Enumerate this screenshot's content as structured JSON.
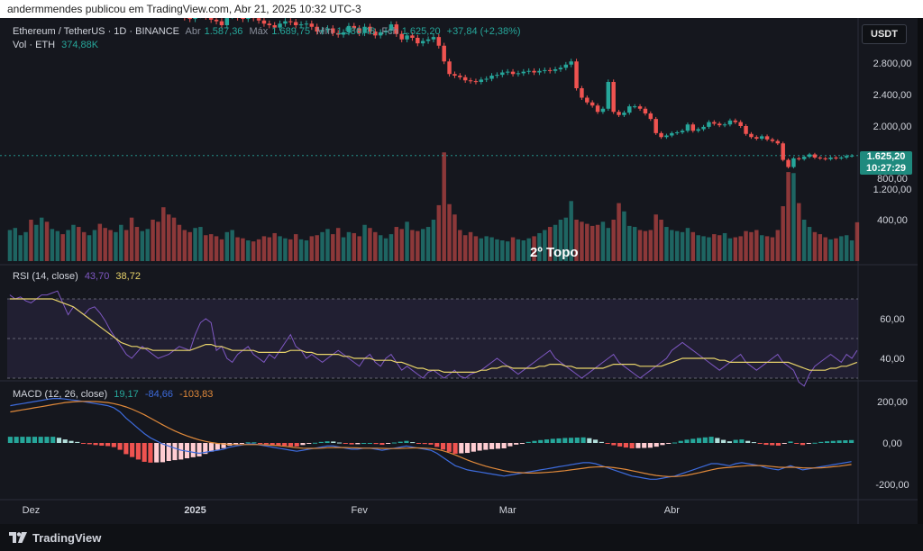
{
  "header": {
    "credit": "andermmendes publicou em TradingView.com, Abr 21, 2025 10:32 UTC-3"
  },
  "symbol": {
    "name": "Ethereum / TetherUS · 1D · BINANCE",
    "open_label": "Abr",
    "open": "1.587,36",
    "high_label": "Máx",
    "high": "1.689,75",
    "low_label": "Mín",
    "low": "1.586,48",
    "close_label": "Fch",
    "close": "1.625,20",
    "change": "+37,84 (+2,38%)"
  },
  "volume": {
    "label": "Vol · ETH",
    "value": "374,88K"
  },
  "rsi": {
    "label": "RSI (14, close)",
    "value1": "43,70",
    "value2": "38,72"
  },
  "macd": {
    "label": "MACD (12, 26, close)",
    "hist": "19,17",
    "macd": "-84,66",
    "signal": "-103,83"
  },
  "currency_button": "USDT",
  "price_tag": {
    "price": "1.625,20",
    "countdown": "10:27:29"
  },
  "annotation": "2º Topo",
  "footer": {
    "brand": "TradingView"
  },
  "colors": {
    "up": "#26a69a",
    "down": "#ef5350",
    "rsi": "#7e57c2",
    "rsi_ma": "#e8d36a",
    "macd": "#3d6bdc",
    "signal": "#e0893a",
    "background": "#15171e"
  },
  "chart_data": [
    {
      "type": "candlestick",
      "title": "Ethereum / TetherUS · 1D · BINANCE",
      "x_ticks": [
        "Dez",
        "2025",
        "Fev",
        "Mar",
        "Abr"
      ],
      "y_ticks": [
        {
          "value": 2800,
          "label": "2.800,00"
        },
        {
          "value": 2400,
          "label": "2.400,00"
        },
        {
          "value": 2000,
          "label": "2.000,00"
        },
        {
          "value": 1200,
          "label": "1.200,00"
        }
      ],
      "ylim": [
        1200,
        3600
      ],
      "close_series": [
        3600,
        3620,
        3680,
        3700,
        3650,
        3720,
        3800,
        3790,
        3850,
        3900,
        3880,
        3950,
        3980,
        3940,
        3900,
        3960,
        3980,
        3920,
        3870,
        3800,
        3900,
        3960,
        3920,
        3880,
        3850,
        3920,
        3980,
        3960,
        3900,
        3850,
        3700,
        3550,
        3420,
        3380,
        3360,
        3410,
        3480,
        3390,
        3350,
        3330,
        3280,
        3400,
        3450,
        3380,
        3360,
        3400,
        3370,
        3340,
        3300,
        3280,
        3250,
        3300,
        3330,
        3320,
        3280,
        3290,
        3300,
        3260,
        3200,
        3220,
        3240,
        3180,
        3160,
        3190,
        3270,
        3240,
        3180,
        3260,
        3200,
        3150,
        3190,
        3210,
        3290,
        3170,
        3100,
        3150,
        3120,
        3050,
        3080,
        3100,
        3130,
        3020,
        2820,
        2660,
        2640,
        2620,
        2580,
        2570,
        2560,
        2590,
        2600,
        2640,
        2650,
        2680,
        2690,
        2660,
        2670,
        2690,
        2700,
        2680,
        2700,
        2710,
        2700,
        2720,
        2740,
        2780,
        2820,
        2480,
        2360,
        2300,
        2260,
        2180,
        2220,
        2560,
        2180,
        2140,
        2170,
        2250,
        2250,
        2220,
        2160,
        2090,
        1910,
        1860,
        1880,
        1910,
        1920,
        1940,
        2020,
        1940,
        1960,
        1990,
        2050,
        2030,
        2010,
        2020,
        2070,
        2050,
        2000,
        1900,
        1860,
        1840,
        1870,
        1830,
        1810,
        1780,
        1570,
        1480,
        1590,
        1580,
        1610,
        1640,
        1600,
        1590,
        1580,
        1600,
        1590,
        1600,
        1620,
        1625
      ]
    },
    {
      "type": "bar",
      "name": "Vol · ETH",
      "y_ticks": [
        {
          "value": 800000,
          "label": "800,00"
        },
        {
          "value": 400000,
          "label": "400,00"
        }
      ],
      "ylim": [
        0,
        1000000
      ],
      "values": [
        300000,
        320000,
        250000,
        280000,
        400000,
        350000,
        420000,
        380000,
        310000,
        290000,
        260000,
        300000,
        350000,
        330000,
        280000,
        250000,
        300000,
        360000,
        320000,
        300000,
        280000,
        350000,
        300000,
        420000,
        330000,
        290000,
        310000,
        400000,
        380000,
        520000,
        450000,
        420000,
        350000,
        300000,
        280000,
        320000,
        330000,
        250000,
        260000,
        240000,
        210000,
        280000,
        300000,
        230000,
        220000,
        200000,
        190000,
        210000,
        240000,
        230000,
        270000,
        240000,
        220000,
        210000,
        260000,
        210000,
        200000,
        240000,
        250000,
        280000,
        310000,
        260000,
        320000,
        230000,
        280000,
        270000,
        240000,
        350000,
        320000,
        280000,
        250000,
        220000,
        260000,
        330000,
        310000,
        380000,
        300000,
        290000,
        310000,
        330000,
        400000,
        540000,
        1050000,
        550000,
        450000,
        300000,
        250000,
        280000,
        240000,
        220000,
        240000,
        230000,
        210000,
        200000,
        190000,
        230000,
        210000,
        200000,
        220000,
        240000,
        270000,
        300000,
        330000,
        350000,
        400000,
        420000,
        580000,
        400000,
        380000,
        360000,
        340000,
        350000,
        380000,
        320000,
        400000,
        560000,
        480000,
        340000,
        330000,
        300000,
        290000,
        300000,
        450000,
        400000,
        330000,
        300000,
        290000,
        280000,
        320000,
        280000,
        250000,
        240000,
        230000,
        260000,
        250000,
        270000,
        220000,
        230000,
        240000,
        290000,
        280000,
        300000,
        250000,
        240000,
        230000,
        300000,
        530000,
        860000,
        850000,
        560000,
        400000,
        330000,
        280000,
        260000,
        230000,
        210000,
        220000,
        240000,
        250000,
        200000,
        375000
      ]
    },
    {
      "type": "line",
      "name": "RSI (14, close)",
      "y_ticks": [
        {
          "value": 60,
          "label": "60,00"
        },
        {
          "value": 40,
          "label": "40,00"
        }
      ],
      "ylim": [
        20,
        80
      ],
      "bands": [
        70,
        50,
        30
      ],
      "series": [
        {
          "name": "RSI",
          "values": [
            72,
            70,
            71,
            69,
            68,
            70,
            72,
            72,
            73,
            74,
            68,
            62,
            66,
            64,
            62,
            65,
            66,
            63,
            59,
            54,
            50,
            46,
            42,
            40,
            43,
            46,
            44,
            42,
            40,
            41,
            42,
            44,
            46,
            45,
            44,
            52,
            58,
            60,
            58,
            44,
            46,
            40,
            38,
            42,
            44,
            46,
            42,
            40,
            38,
            42,
            40,
            44,
            48,
            52,
            46,
            44,
            40,
            42,
            40,
            38,
            40,
            42,
            44,
            42,
            40,
            38,
            36,
            40,
            42,
            38,
            36,
            40,
            42,
            38,
            34,
            36,
            34,
            32,
            30,
            33,
            34,
            32,
            30,
            32,
            34,
            31,
            30,
            32,
            33,
            34,
            36,
            38,
            40,
            38,
            36,
            34,
            32,
            34,
            36,
            38,
            40,
            42,
            44,
            40,
            38,
            36,
            34,
            32,
            30,
            32,
            34,
            36,
            38,
            40,
            42,
            38,
            36,
            34,
            32,
            30,
            32,
            34,
            36,
            38,
            40,
            44,
            46,
            48,
            46,
            44,
            42,
            40,
            38,
            36,
            34,
            36,
            38,
            40,
            42,
            38,
            36,
            34,
            36,
            38,
            40,
            42,
            38,
            36,
            34,
            28,
            26,
            32,
            36,
            38,
            40,
            42,
            40,
            38,
            42,
            40,
            44
          ],
          "color": "#7e57c2"
        },
        {
          "name": "RSI MA",
          "values": [
            70,
            70,
            70,
            70,
            70,
            70,
            70,
            70,
            70,
            69,
            68,
            67,
            66,
            64,
            62,
            60,
            58,
            56,
            54,
            52,
            50,
            48,
            47,
            46,
            46,
            45,
            45,
            44,
            44,
            44,
            44,
            44,
            44,
            44,
            44,
            45,
            46,
            47,
            47,
            46,
            46,
            45,
            44,
            44,
            44,
            44,
            44,
            43,
            43,
            43,
            43,
            43,
            43,
            44,
            44,
            44,
            43,
            43,
            42,
            42,
            42,
            42,
            42,
            41,
            41,
            40,
            40,
            40,
            40,
            39,
            39,
            39,
            39,
            38,
            38,
            37,
            36,
            35,
            35,
            34,
            34,
            34,
            33,
            33,
            33,
            33,
            33,
            33,
            33,
            34,
            34,
            35,
            35,
            36,
            36,
            35,
            35,
            35,
            35,
            35,
            36,
            36,
            37,
            37,
            37,
            36,
            36,
            35,
            35,
            35,
            35,
            35,
            35,
            36,
            37,
            37,
            37,
            37,
            37,
            36,
            36,
            36,
            36,
            36,
            37,
            38,
            39,
            40,
            40,
            40,
            40,
            40,
            40,
            40,
            39,
            39,
            38,
            38,
            38,
            38,
            38,
            38,
            38,
            38,
            38,
            38,
            38,
            38,
            37,
            36,
            35,
            34,
            34,
            34,
            34,
            35,
            35,
            36,
            36,
            37,
            38
          ],
          "color": "#e8d36a"
        }
      ]
    },
    {
      "type": "line",
      "name": "MACD (12, 26, close)",
      "y_ticks": [
        {
          "value": 200,
          "label": "200,00"
        },
        {
          "value": 0,
          "label": "0,00"
        },
        {
          "value": -200,
          "label": "-200,00"
        }
      ],
      "ylim": [
        -230,
        230
      ],
      "series": [
        {
          "name": "MACD",
          "values": [
            180,
            185,
            190,
            195,
            200,
            205,
            210,
            215,
            215,
            212,
            208,
            205,
            200,
            195,
            190,
            185,
            180,
            170,
            150,
            120,
            95,
            70,
            45,
            25,
            10,
            -5,
            -15,
            -25,
            -35,
            -40,
            -45,
            -50,
            -45,
            -40,
            -35,
            -30,
            -20,
            -15,
            -10,
            -5,
            -5,
            -10,
            -15,
            -20,
            -25,
            -30,
            -35,
            -40,
            -35,
            -30,
            -25,
            -20,
            -15,
            -15,
            -20,
            -25,
            -30,
            -30,
            -25,
            -25,
            -30,
            -35,
            -30,
            -25,
            -20,
            -15,
            -20,
            -25,
            -30,
            -35,
            -50,
            -70,
            -90,
            -110,
            -120,
            -130,
            -135,
            -140,
            -145,
            -150,
            -155,
            -160,
            -155,
            -150,
            -145,
            -140,
            -135,
            -130,
            -125,
            -120,
            -115,
            -110,
            -105,
            -100,
            -95,
            -95,
            -100,
            -110,
            -120,
            -130,
            -140,
            -150,
            -160,
            -165,
            -170,
            -175,
            -175,
            -170,
            -165,
            -160,
            -150,
            -140,
            -130,
            -120,
            -110,
            -100,
            -100,
            -105,
            -110,
            -100,
            -95,
            -100,
            -105,
            -110,
            -120,
            -125,
            -130,
            -120,
            -110,
            -120,
            -130,
            -125,
            -120,
            -115,
            -110,
            -105,
            -100,
            -95,
            -90
          ],
          "color": "#3d6bdc"
        },
        {
          "name": "Signal",
          "values": [
            150,
            155,
            160,
            165,
            170,
            175,
            180,
            185,
            190,
            195,
            198,
            200,
            201,
            201,
            200,
            198,
            195,
            190,
            183,
            174,
            163,
            150,
            136,
            120,
            104,
            88,
            72,
            58,
            45,
            34,
            24,
            15,
            8,
            2,
            -2,
            -5,
            -7,
            -8,
            -8,
            -8,
            -8,
            -8,
            -9,
            -11,
            -13,
            -16,
            -19,
            -23,
            -25,
            -26,
            -26,
            -25,
            -23,
            -22,
            -22,
            -22,
            -23,
            -24,
            -25,
            -25,
            -25,
            -26,
            -27,
            -27,
            -26,
            -25,
            -24,
            -24,
            -25,
            -27,
            -31,
            -38,
            -47,
            -58,
            -70,
            -82,
            -93,
            -103,
            -112,
            -120,
            -127,
            -134,
            -139,
            -142,
            -144,
            -145,
            -145,
            -144,
            -142,
            -140,
            -137,
            -134,
            -130,
            -126,
            -122,
            -118,
            -116,
            -115,
            -116,
            -119,
            -123,
            -128,
            -134,
            -140,
            -146,
            -152,
            -157,
            -160,
            -162,
            -162,
            -160,
            -156,
            -150,
            -144,
            -137,
            -130,
            -124,
            -120,
            -118,
            -115,
            -112,
            -110,
            -109,
            -109,
            -111,
            -114,
            -117,
            -118,
            -117,
            -118,
            -120,
            -121,
            -121,
            -120,
            -118,
            -115,
            -112,
            -108,
            -104
          ],
          "color": "#e0893a"
        }
      ]
    }
  ]
}
